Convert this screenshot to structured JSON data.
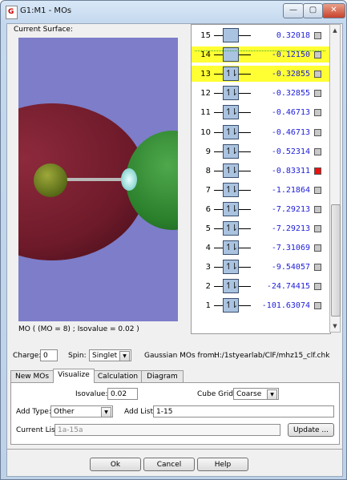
{
  "window": {
    "title": "G1:M1 - MOs",
    "app_icon_glyph": "G"
  },
  "titlebar_buttons": {
    "minimize": "—",
    "maximize": "▢",
    "close": "✕"
  },
  "surface": {
    "label": "Current Surface:",
    "status": "MO ( (MO = 8) ; Isovalue = 0.02 )"
  },
  "colors": {
    "lobe_red": "#7a1e30",
    "lobe_green": "#2c8a30",
    "background": "#7d7dc9",
    "highlight": "#ffff33",
    "energy_text": "#1d1dd9"
  },
  "mo_list": [
    {
      "num": "15",
      "occ": "",
      "energy": "0.32018",
      "highlight": false,
      "checked": false
    },
    {
      "num": "14",
      "occ": "",
      "energy": "-0.12150",
      "highlight": true,
      "checked": false
    },
    {
      "num": "13",
      "occ": "↿⇂",
      "energy": "-0.32855",
      "highlight": true,
      "checked": false
    },
    {
      "num": "12",
      "occ": "↿⇂",
      "energy": "-0.32855",
      "highlight": false,
      "checked": false
    },
    {
      "num": "11",
      "occ": "↿⇂",
      "energy": "-0.46713",
      "highlight": false,
      "checked": false
    },
    {
      "num": "10",
      "occ": "↿⇂",
      "energy": "-0.46713",
      "highlight": false,
      "checked": false
    },
    {
      "num": "9",
      "occ": "↿⇂",
      "energy": "-0.52314",
      "highlight": false,
      "checked": false
    },
    {
      "num": "8",
      "occ": "↿⇂",
      "energy": "-0.83311",
      "highlight": false,
      "checked": true
    },
    {
      "num": "7",
      "occ": "↿⇂",
      "energy": "-1.21864",
      "highlight": false,
      "checked": false
    },
    {
      "num": "6",
      "occ": "↿⇂",
      "energy": "-7.29213",
      "highlight": false,
      "checked": false
    },
    {
      "num": "5",
      "occ": "↿⇂",
      "energy": "-7.29213",
      "highlight": false,
      "checked": false
    },
    {
      "num": "4",
      "occ": "↿⇂",
      "energy": "-7.31069",
      "highlight": false,
      "checked": false
    },
    {
      "num": "3",
      "occ": "↿⇂",
      "energy": "-9.54057",
      "highlight": false,
      "checked": false
    },
    {
      "num": "2",
      "occ": "↿⇂",
      "energy": "-24.74415",
      "highlight": false,
      "checked": false
    },
    {
      "num": "1",
      "occ": "↿⇂",
      "energy": "-101.63074",
      "highlight": false,
      "checked": false
    }
  ],
  "scrollbar": {
    "up": "▲",
    "down": "▼"
  },
  "charge": {
    "label": "Charge:",
    "value": "0"
  },
  "spin": {
    "label": "Spin:",
    "value": "Singlet",
    "arrow": "▼"
  },
  "source": {
    "label": "Gaussian MOs from:",
    "path": "H:/1styearlab/ClF/mhz15_clf.chk"
  },
  "tabs": [
    "New MOs",
    "Visualize",
    "Calculation",
    "Diagram"
  ],
  "visualize": {
    "isovalue_label": "Isovalue:",
    "isovalue": "0.02",
    "cube_grid_label": "Cube Grid:",
    "cube_grid": "Coarse",
    "add_type_label": "Add Type:",
    "add_type": "Other",
    "add_list_label": "Add List:",
    "add_list": "1-15",
    "current_list_label": "Current List:",
    "current_list": "1a-15a",
    "update_button": "Update ..."
  },
  "buttons": {
    "ok": "Ok",
    "cancel": "Cancel",
    "help": "Help"
  }
}
